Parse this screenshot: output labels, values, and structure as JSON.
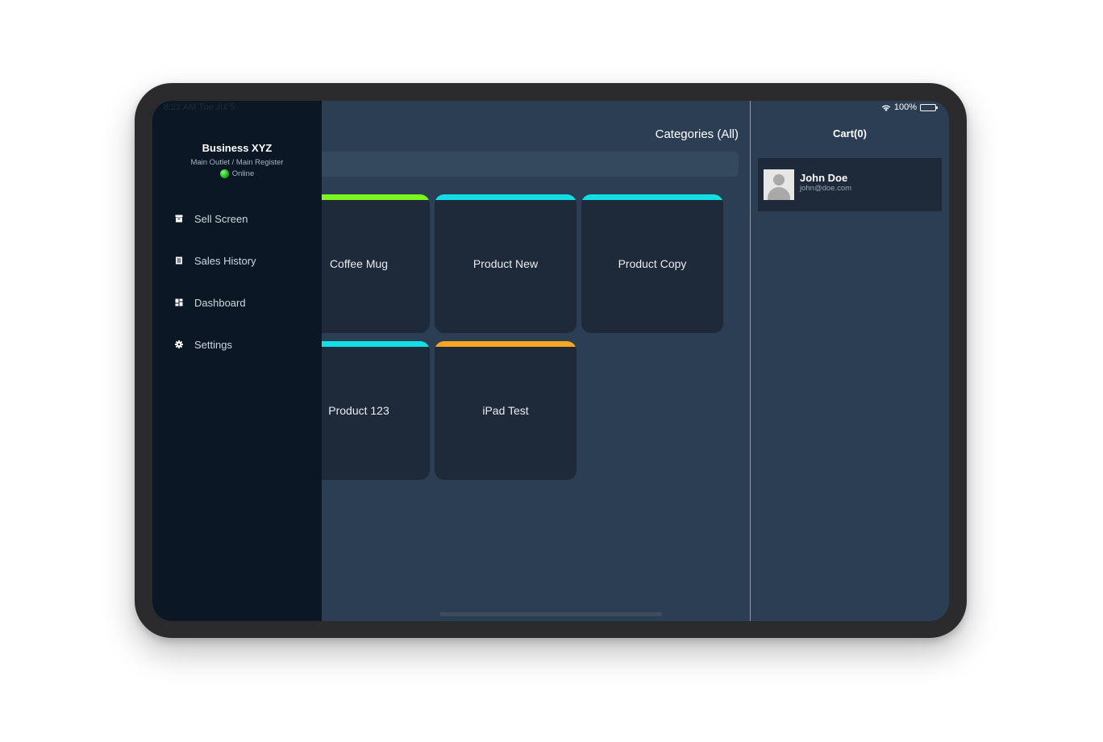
{
  "status_bar": {
    "time_date": "8:22 AM   Tue Jul 5",
    "battery": "100%"
  },
  "sidebar": {
    "business_name": "Business XYZ",
    "outlet_register": "Main Outlet / Main Register",
    "connection_status": "Online",
    "items": [
      {
        "label": "Sell Screen",
        "icon": "register-icon"
      },
      {
        "label": "Sales History",
        "icon": "list-icon"
      },
      {
        "label": "Dashboard",
        "icon": "dashboard-icon"
      },
      {
        "label": "Settings",
        "icon": "gear-icon"
      }
    ]
  },
  "main": {
    "categories_label": "Categories (All)",
    "search": {
      "placeholder": ""
    },
    "products": [
      {
        "name": "Coffee Mug",
        "color": "#7cf51f"
      },
      {
        "name": "Product New",
        "color": "#12dfe5"
      },
      {
        "name": "Product Copy",
        "color": "#12dfe5"
      },
      {
        "name": "Product 123",
        "color": "#12dfe5"
      },
      {
        "name": "iPad Test",
        "color": "#f5a623"
      }
    ]
  },
  "cart": {
    "title": "Cart(0)",
    "customer": {
      "name": "John Doe",
      "email": "john@doe.com"
    }
  }
}
